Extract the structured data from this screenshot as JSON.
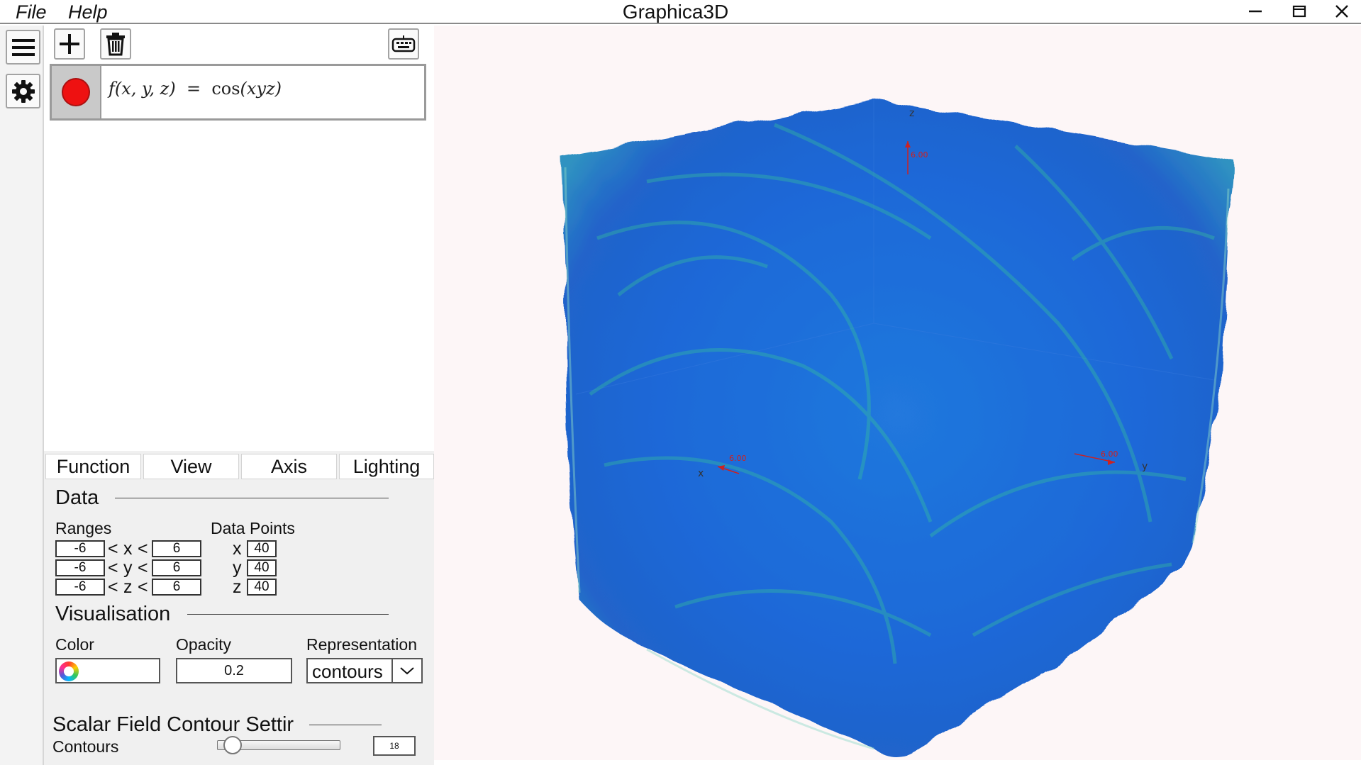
{
  "window": {
    "title": "Graphica3D"
  },
  "menu": {
    "file": "File",
    "help": "Help"
  },
  "function_row": {
    "color": "#ee1111",
    "lhs_f": "f",
    "lhs_args": "(x, y, z)",
    "equals": "=",
    "rhs_fn": "cos",
    "rhs_args": "(xyz)"
  },
  "icons": [
    "hamburger-menu-icon",
    "gear-icon",
    "plus-icon",
    "trash-icon",
    "keyboard-icon",
    "minimize-icon",
    "maximize-icon",
    "close-icon",
    "color-wheel-icon",
    "chevron-down-icon"
  ],
  "tabs": {
    "function": "Function",
    "view": "View",
    "axis": "Axis",
    "lighting": "Lighting"
  },
  "data_section": {
    "title": "Data",
    "ranges_label": "Ranges",
    "data_points_label": "Data Points",
    "lt": "<",
    "ranges": [
      {
        "axis": "x",
        "min": "-6",
        "max": "6",
        "points": "40"
      },
      {
        "axis": "y",
        "min": "-6",
        "max": "6",
        "points": "40"
      },
      {
        "axis": "z",
        "min": "-6",
        "max": "6",
        "points": "40"
      }
    ]
  },
  "visualisation": {
    "title": "Visualisation",
    "color_label": "Color",
    "opacity_label": "Opacity",
    "opacity_value": "0.2",
    "representation_label": "Representation",
    "representation_value": "contours"
  },
  "contour_settings": {
    "title": "Scalar Field Contour Settir",
    "contours_label": "Contours",
    "contours_value": "18",
    "contours_fraction": 0.05
  },
  "viewport": {
    "axis_x": "x",
    "axis_y": "y",
    "axis_z": "z",
    "tick_x": "6.00",
    "tick_y": "6.00",
    "tick_z": "6.00",
    "colors": {
      "volume": "#1565d8",
      "highlight": "#37c49a",
      "background": "#fdf6f7"
    }
  }
}
